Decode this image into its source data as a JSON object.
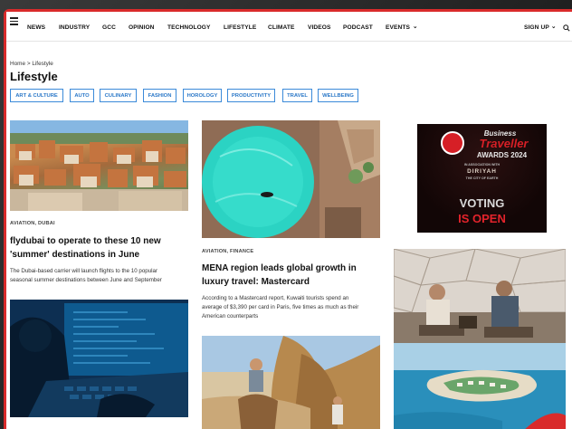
{
  "nav": {
    "items": [
      "NEWS",
      "INDUSTRY",
      "GCC",
      "OPINION",
      "TECHNOLOGY",
      "LIFESTYLE",
      "CLIMATE",
      "VIDEOS",
      "PODCAST",
      "EVENTS"
    ],
    "events_chevron": "⌄",
    "signup": "SIGN UP",
    "signup_chevron": "⌄"
  },
  "breadcrumb": "Home > Lifestyle",
  "page_title": "Lifestyle",
  "chips": [
    "ART & CULTURE",
    "AUTO",
    "CULINARY",
    "FASHION",
    "HOROLOGY",
    "PRODUCTIVITY",
    "TRAVEL",
    "WELLBEING"
  ],
  "articles": [
    {
      "tag": "AVIATION, DUBAI",
      "headline_l1": "flydubai to operate to these 10 new",
      "headline_l2": "'summer' destinations in June",
      "excerpt_l1": "The Dubai-based carrier will launch flights to the 10 popular",
      "excerpt_l2": "seasonal summer destinations between June and September"
    },
    {
      "tag": "AVIATION, FINANCE",
      "headline_l1": "MENA region leads global growth in",
      "headline_l2": "luxury travel: Mastercard",
      "excerpt_l1": "According to a Mastercard report, Kuwaiti tourists spend an",
      "excerpt_l2": "average of $3,390 per card in Paris, five times as much as their",
      "excerpt_l3": "American counterparts"
    }
  ],
  "ad": {
    "brand_l1": "Business",
    "brand_l2": "Traveller",
    "brand_l3": "AWARDS 2024",
    "partner_l1": "IN ASSOCIATION WITH",
    "partner_l2": "DIRIYAH",
    "partner_l3": "THE CITY OF EARTH",
    "vote_l1": "VOTING",
    "vote_l2": "IS OPEN"
  },
  "colors": {
    "frame_red": "#d92b2b",
    "chip_blue": "#2b78c8"
  }
}
